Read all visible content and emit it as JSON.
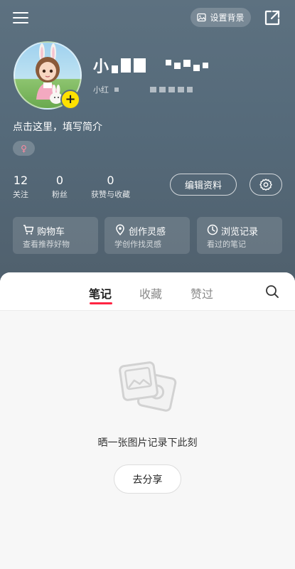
{
  "header": {
    "set_background_label": "设置背景"
  },
  "profile": {
    "username_visible": "小",
    "subid_prefix": "小红",
    "bio": "点击这里，填写简介",
    "gender_symbol": "♀"
  },
  "stats": [
    {
      "num": "12",
      "label": "关注"
    },
    {
      "num": "0",
      "label": "粉丝"
    },
    {
      "num": "0",
      "label": "获赞与收藏"
    }
  ],
  "actions": {
    "edit_profile_label": "编辑资料"
  },
  "cards": [
    {
      "title": "购物车",
      "sub": "查看推荐好物",
      "icon": "cart-icon"
    },
    {
      "title": "创作灵感",
      "sub": "学创作找灵感",
      "icon": "location-pin-icon"
    },
    {
      "title": "浏览记录",
      "sub": "看过的笔记",
      "icon": "clock-icon"
    }
  ],
  "tabs": [
    {
      "label": "笔记",
      "active": true
    },
    {
      "label": "收藏",
      "active": false
    },
    {
      "label": "赞过",
      "active": false
    }
  ],
  "empty_state": {
    "message": "晒一张图片记录下此刻",
    "button_label": "去分享"
  },
  "colors": {
    "header_bg": "#566a79",
    "accent_red": "#ff2442",
    "plus_badge": "#ffe100"
  }
}
